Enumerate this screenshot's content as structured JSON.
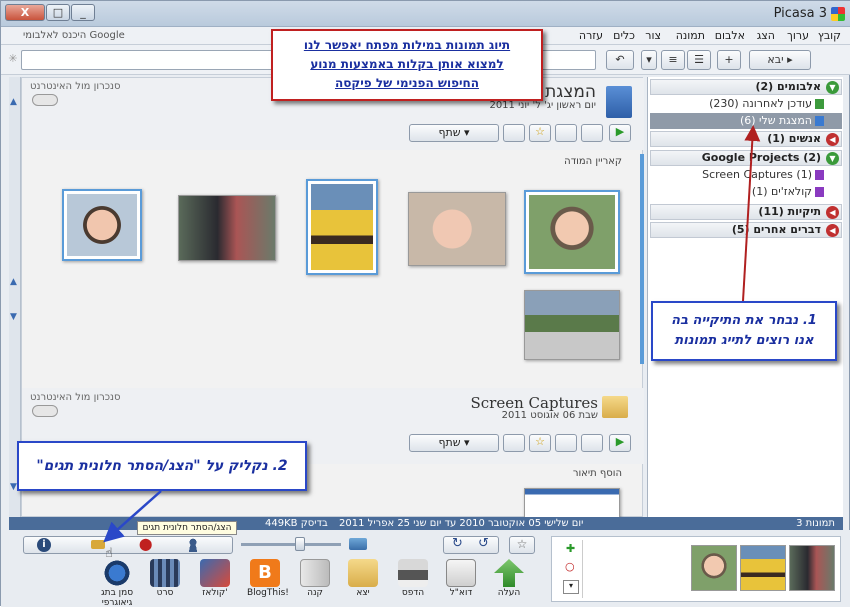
{
  "window": {
    "title": "Picasa 3",
    "close_label": "X",
    "max_label": "□",
    "min_label": "_"
  },
  "menu": {
    "items": [
      "קובץ",
      "ערוך",
      "הצג",
      "אלבום",
      "תמונה",
      "צור",
      "כלים",
      "עזרה"
    ],
    "google_signin": "היכנס לאלבומי Google"
  },
  "toolbar": {
    "import_label": "יבא"
  },
  "tree": {
    "sections": [
      {
        "label": "אלבומים (2)",
        "arrow": "green"
      },
      {
        "label": "אנשים (1)",
        "arrow": "red"
      },
      {
        "label": "Google Projects (2)",
        "arrow": "red"
      },
      {
        "label": "תיקיות (11)",
        "arrow": "red"
      },
      {
        "label": "דברים אחרים (5)",
        "arrow": "red"
      }
    ],
    "albums": [
      "עודכן לאחרונה (230)",
      "המצגת שלי (6)"
    ],
    "projects": [
      "Screen Captures (1)",
      "קולאז'ים (1)"
    ]
  },
  "album1": {
    "title": "המצגת שלי",
    "date": "יום ראשון יג' ל' יוני 2011",
    "sync_label": "סנכרון מול האינטרנט",
    "share_label": "שתף",
    "caption_label": "קאריין המודה"
  },
  "album2": {
    "title": "Screen Captures",
    "date": "שבת 06 אוגוסט 2011",
    "sync_label": "סנכרון מול האינטרנט",
    "share_label": "שתף",
    "caption_label": "הוסף תיאור"
  },
  "status": {
    "count": "3 תמונות",
    "range": "יום שלישי 05 אוקטובר 2010 עד יום שני 25 אפריל 2011",
    "size": "449KB בדיסק",
    "tooltip": "הצג/הסתר חלונית תגים"
  },
  "bottom_actions": [
    {
      "name": "upload",
      "label": "העלה"
    },
    {
      "name": "email",
      "label": "דוא\"ל"
    },
    {
      "name": "print",
      "label": "הדפס"
    },
    {
      "name": "export",
      "label": "יצא"
    },
    {
      "name": "buy",
      "label": "קנה"
    },
    {
      "name": "blog",
      "label": "BlogThis!"
    },
    {
      "name": "collage",
      "label": "קולאז'"
    },
    {
      "name": "movie",
      "label": "סרט"
    },
    {
      "name": "geotag",
      "label": "סמן בתג גיאוגרפי"
    }
  ],
  "callouts": {
    "top": [
      "תיוג תמונות במילות מפתח יאפשר לנו",
      "למצוא אותן בקלות באמצעות מנוע",
      "החיפוש הפנימי של פיקסה"
    ],
    "right": [
      "1. נבחר את התיקייה בה",
      "אנו רוצים לתייג תמונות"
    ],
    "bottom": "2. נקליק על \"הצג/הסתר חלונית תגים\""
  },
  "colors": {
    "status_bg": "#4a6c99",
    "callout_red": "#c02020",
    "callout_blue": "#2a48c8",
    "selected_row": "#8f9aa8"
  }
}
